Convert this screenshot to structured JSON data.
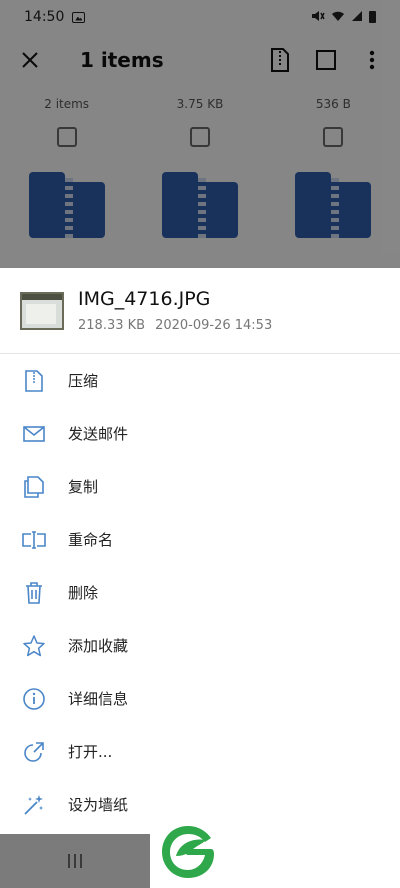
{
  "status_bar": {
    "time": "14:50"
  },
  "app_bar": {
    "title": "1 items"
  },
  "grid": {
    "headers": [
      "2 items",
      "3.75 KB",
      "536 B"
    ]
  },
  "file": {
    "name": "IMG_4716.JPG",
    "size": "218.33 KB",
    "date": "2020-09-26 14:53"
  },
  "menu": [
    {
      "label": "压缩",
      "icon": "zip-file-icon"
    },
    {
      "label": "发送邮件",
      "icon": "mail-icon"
    },
    {
      "label": "复制",
      "icon": "copy-icon"
    },
    {
      "label": "重命名",
      "icon": "rename-icon"
    },
    {
      "label": "删除",
      "icon": "trash-icon"
    },
    {
      "label": "添加收藏",
      "icon": "star-icon"
    },
    {
      "label": "详细信息",
      "icon": "info-icon"
    },
    {
      "label": "打开...",
      "icon": "open-with-icon"
    },
    {
      "label": "设为墙纸",
      "icon": "wallpaper-icon"
    }
  ],
  "colors": {
    "accent": "#4a86c8",
    "folder": "#2e5ca8",
    "logo": "#2ea84a"
  }
}
